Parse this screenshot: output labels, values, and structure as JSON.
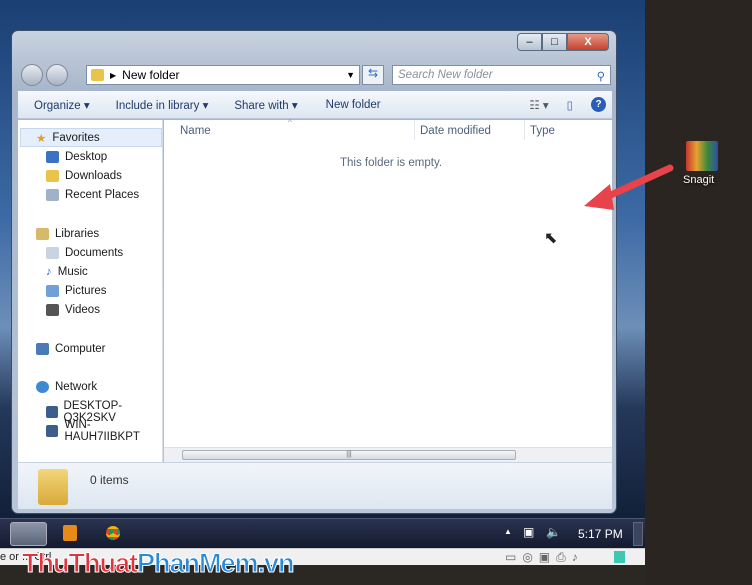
{
  "window": {
    "address": "New folder",
    "search_placeholder": "Search New folder",
    "controls": {
      "minimize": "–",
      "maximize": "□",
      "close": "X"
    }
  },
  "toolbar": {
    "organize": "Organize ▾",
    "include": "Include in library ▾",
    "share": "Share with ▾",
    "new_folder": "New folder"
  },
  "nav": {
    "favorites": "Favorites",
    "desktop": "Desktop",
    "downloads": "Downloads",
    "recent": "Recent Places",
    "libraries": "Libraries",
    "documents": "Documents",
    "music": "Music",
    "pictures": "Pictures",
    "videos": "Videos",
    "computer": "Computer",
    "network": "Network",
    "pc1": "DESKTOP-Q3K2SKV",
    "pc2": "WIN-HAUH7IIBKPT"
  },
  "columns": {
    "name": "Name",
    "date": "Date modified",
    "type": "Type"
  },
  "empty_message": "This folder is empty.",
  "status": {
    "items": "0 items"
  },
  "taskbar": {
    "time": "5:17 PM"
  },
  "vbox_status": "e or ... Ctrl",
  "desktop_icon": {
    "label": "Snagit"
  },
  "watermark": "ThuThuatPhanMem.vn",
  "colors": {
    "arrow": "#e8424a"
  }
}
